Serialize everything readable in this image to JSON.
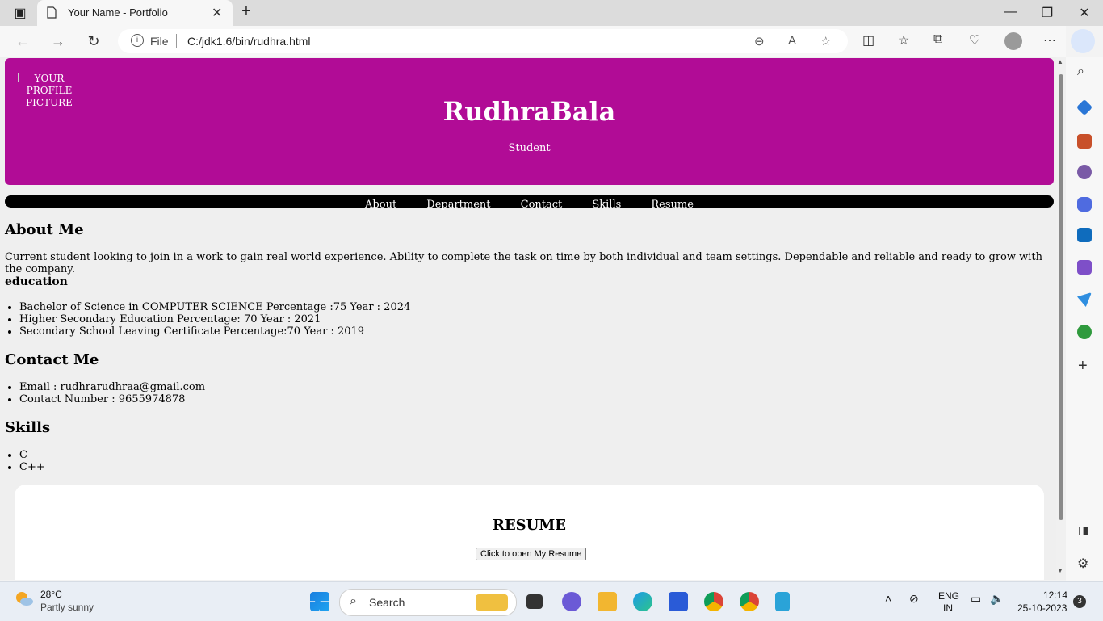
{
  "browser": {
    "tab_title": "Your Name - Portfolio",
    "url_scheme_label": "File",
    "url": "C:/jdk1.6/bin/rudhra.html"
  },
  "header": {
    "profile_alt": "YOUR PROFILE PICTURE",
    "name": "RudhraBala",
    "role": "Student",
    "color": "#b10c96"
  },
  "nav": {
    "items": [
      "About",
      "Department",
      "Contact",
      "Skills",
      "Resume"
    ]
  },
  "about": {
    "heading": "About Me",
    "text": "Current student looking to join in a work to gain real world experience. Ability to complete the task on time by both individual and team settings. Dependable and reliable and ready to grow with the company."
  },
  "education": {
    "heading": "education",
    "items": [
      "Bachelor of Science in COMPUTER SCIENCE Percentage :75 Year : 2024",
      "Higher Secondary Education Percentage: 70 Year : 2021",
      "Secondary School Leaving Certificate Percentage:70 Year : 2019"
    ]
  },
  "contact": {
    "heading": "Contact Me",
    "items": [
      "Email : rudhrarudhraa@gmail.com",
      "Contact Number : 9655974878"
    ]
  },
  "skills": {
    "heading": "Skills",
    "items": [
      "C",
      "C++"
    ]
  },
  "resume": {
    "heading": "RESUME",
    "button": "Click to open My Resume"
  },
  "taskbar": {
    "temperature": "28°C",
    "condition": "Partly sunny",
    "search_label": "Search",
    "lang_top": "ENG",
    "lang_bottom": "IN",
    "time": "12:14",
    "date": "25-10-2023",
    "notification_count": "3"
  }
}
